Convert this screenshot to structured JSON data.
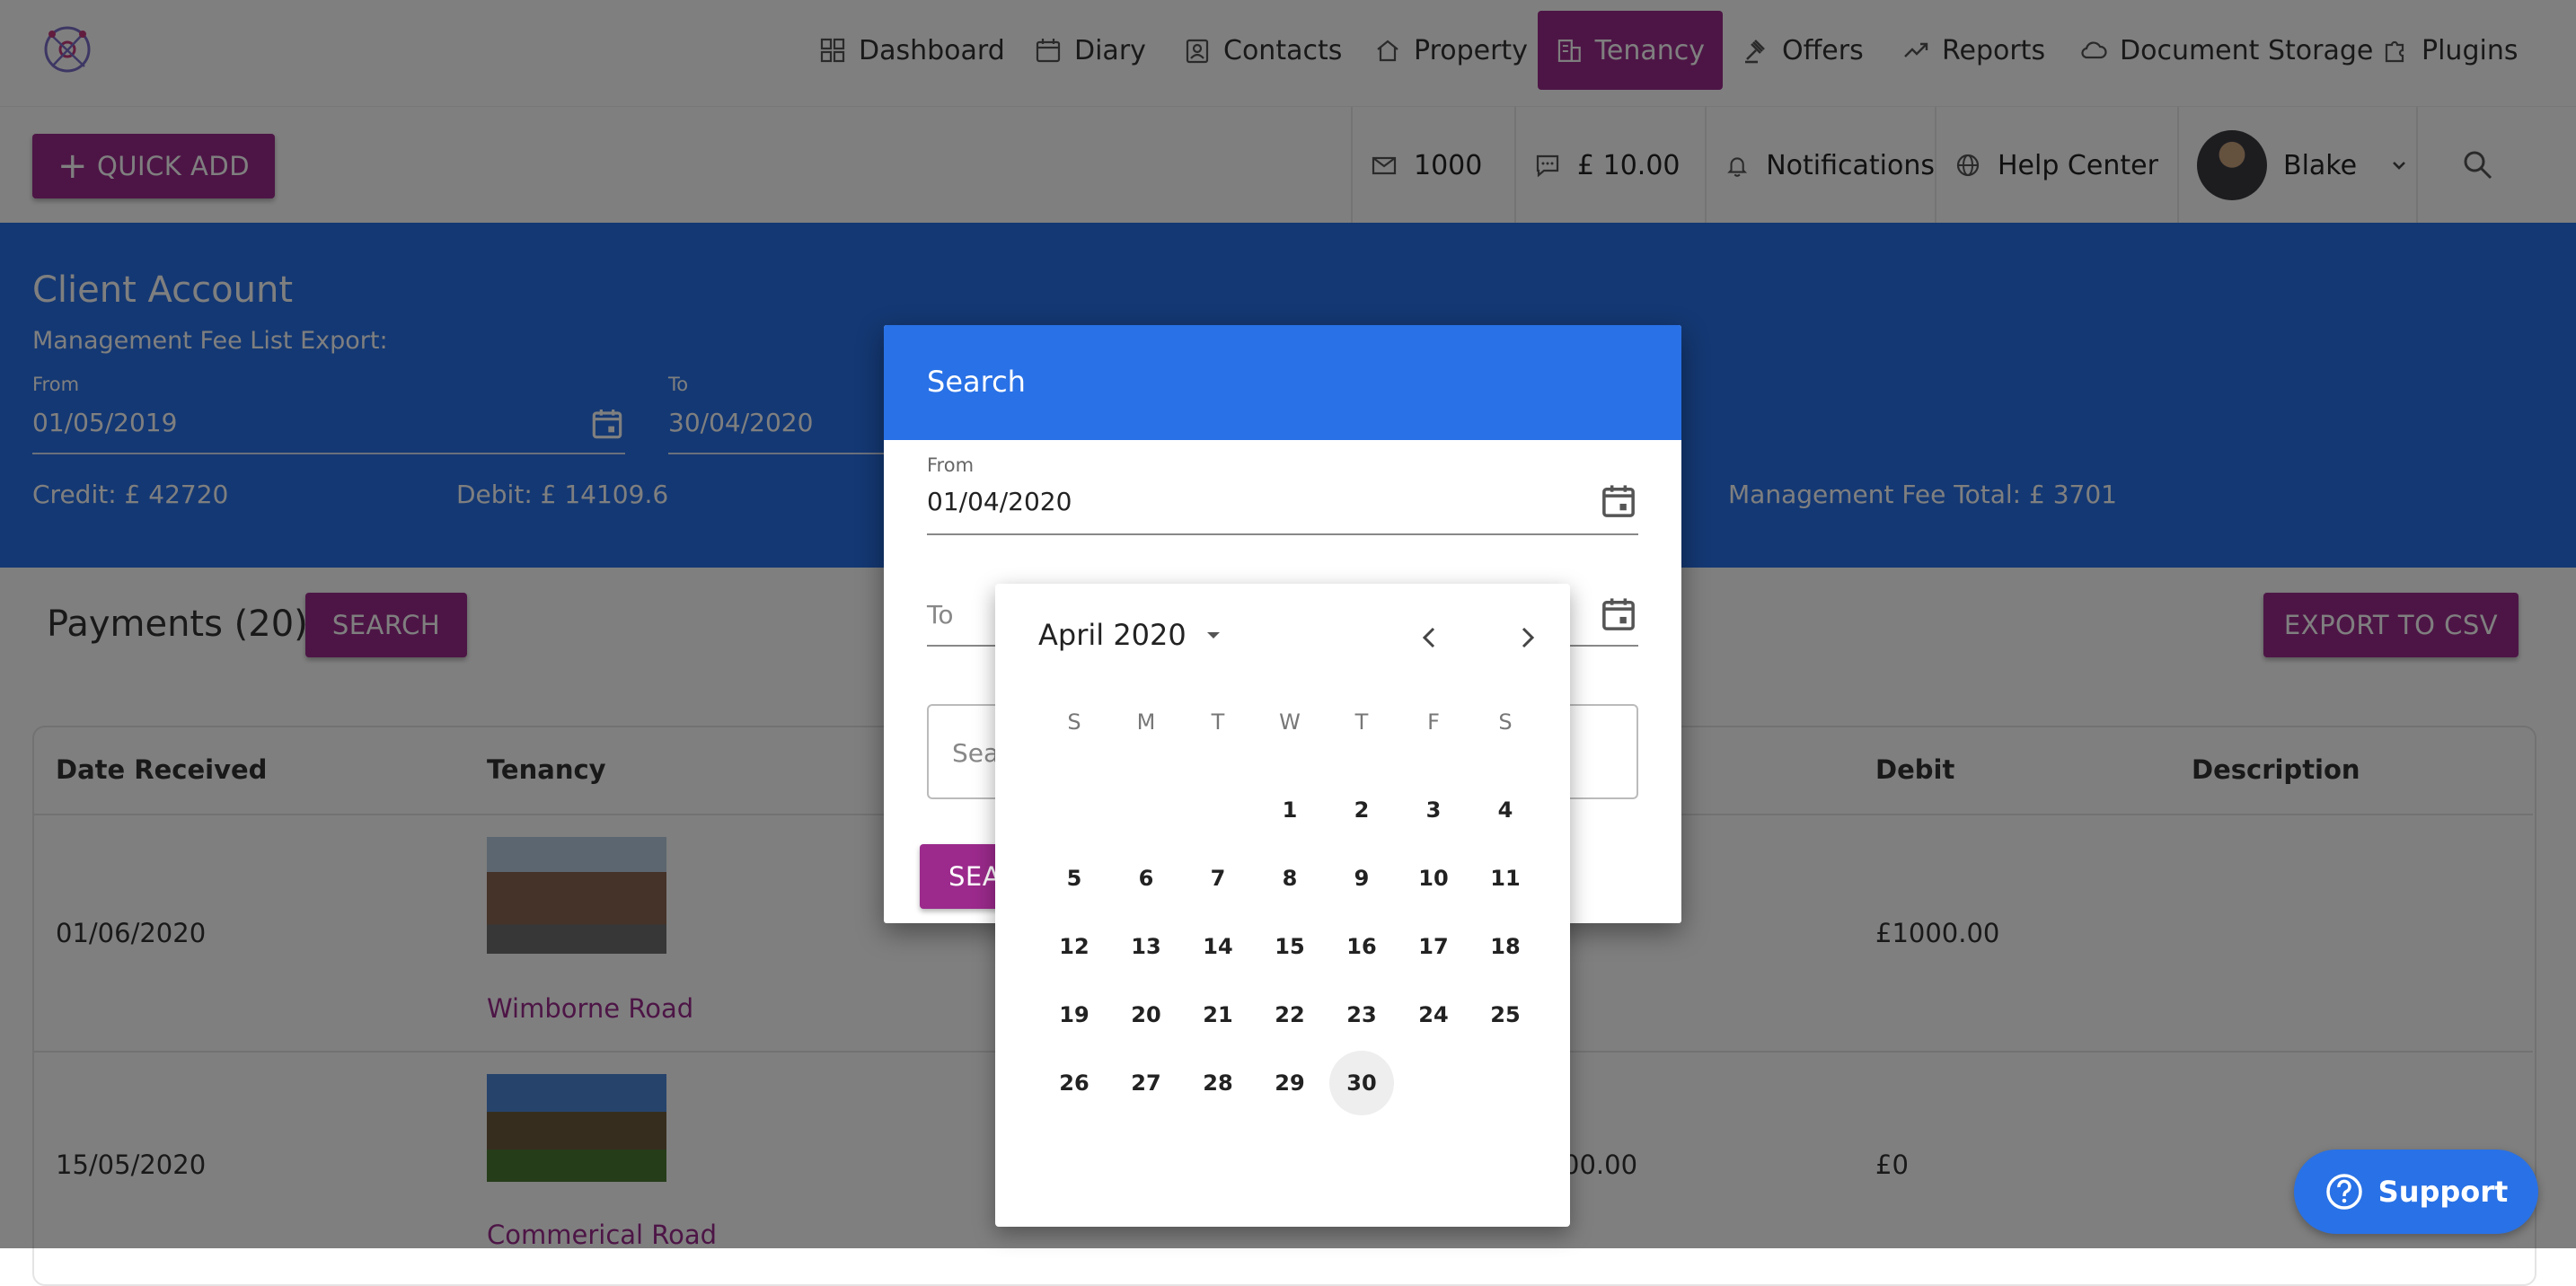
{
  "nav": {
    "items": [
      {
        "label": "Dashboard",
        "icon": "dashboard-icon"
      },
      {
        "label": "Diary",
        "icon": "calendar-icon"
      },
      {
        "label": "Contacts",
        "icon": "contacts-icon"
      },
      {
        "label": "Property",
        "icon": "home-icon"
      },
      {
        "label": "Tenancy",
        "icon": "building-icon",
        "active": true
      },
      {
        "label": "Offers",
        "icon": "gavel-icon"
      },
      {
        "label": "Reports",
        "icon": "trending-icon"
      },
      {
        "label": "Document Storage",
        "icon": "cloud-icon"
      },
      {
        "label": "Plugins",
        "icon": "puzzle-icon"
      }
    ]
  },
  "toolbar": {
    "quick_add": "QUICK ADD",
    "messages_count": "1000",
    "sms_credit": "£ 10.00",
    "notifications": "Notifications",
    "help_center": "Help Center",
    "user_name": "Blake"
  },
  "banner": {
    "title": "Client Account",
    "subtitle": "Management Fee List Export:",
    "from_label": "From",
    "from_value": "01/05/2019",
    "to_label": "To",
    "to_value": "30/04/2020",
    "credit": "Credit: £ 42720",
    "debit": "Debit: £ 14109.6",
    "management_fee_total": "Management Fee Total: £ 3701"
  },
  "payments": {
    "title": "Payments (20)",
    "search_button": "SEARCH",
    "export_button": "EXPORT TO CSV",
    "columns": [
      "Date Received",
      "Tenancy",
      "Debit",
      "Description"
    ],
    "rows": [
      {
        "date": "01/06/2020",
        "tenancy": "Wimborne Road",
        "credit_partial": "",
        "debit": "£1000.00"
      },
      {
        "date": "15/05/2020",
        "tenancy": "Commerical Road",
        "credit_partial": "00.00",
        "debit": "£0"
      }
    ]
  },
  "modal": {
    "title": "Search",
    "from_label": "From",
    "from_value": "01/04/2020",
    "to_placeholder": "To",
    "search_placeholder": "Sea",
    "search_button": "SEA"
  },
  "datepicker": {
    "month_label": "April 2020",
    "weekdays": [
      "S",
      "M",
      "T",
      "W",
      "T",
      "F",
      "S"
    ],
    "first_weekday_index": 3,
    "days_in_month": 30,
    "today": 30
  },
  "support": {
    "label": "Support"
  },
  "colors": {
    "primary": "#9b2a8c",
    "blue": "#2971e6"
  }
}
